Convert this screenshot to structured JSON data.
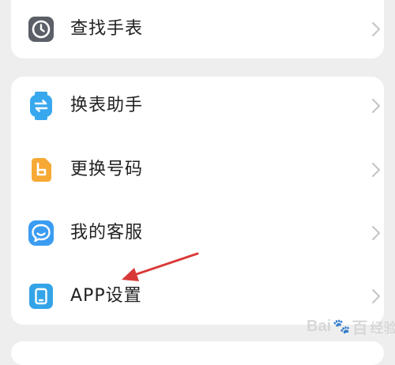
{
  "colors": {
    "background": "#eeeeee",
    "card": "#ffffff",
    "text": "#222222",
    "chevron": "#c4c4c4",
    "annotation_arrow": "#d93838",
    "icon_find_watch": "#5b5f68",
    "icon_swap_helper": "#38a8ee",
    "icon_change_number": "#f7a935",
    "icon_customer_service": "#3b9df2",
    "icon_app_settings": "#34a4e8"
  },
  "menu_groups": [
    {
      "items": [
        {
          "label": "查找手表",
          "icon": "watch-face-icon"
        }
      ]
    },
    {
      "items": [
        {
          "label": "换表助手",
          "icon": "swap-arrows-icon"
        },
        {
          "label": "更换号码",
          "icon": "number-card-icon"
        },
        {
          "label": "我的客服",
          "icon": "chat-bubble-icon"
        },
        {
          "label": "APP设置",
          "icon": "phone-settings-icon"
        }
      ]
    }
  ],
  "watermark": {
    "brand_left": "Bai",
    "brand_right": "百",
    "suffix": "经验"
  }
}
